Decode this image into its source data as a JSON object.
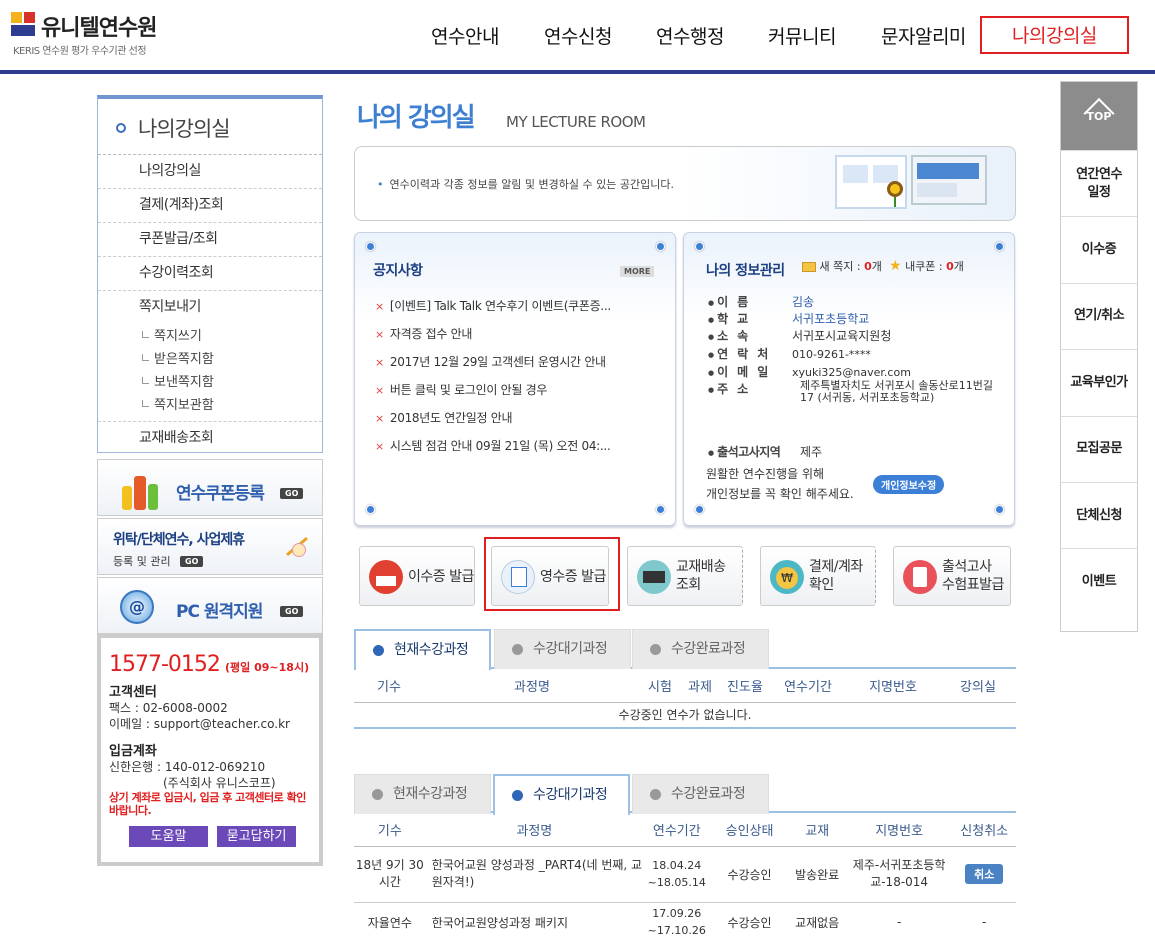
{
  "header": {
    "logo_title": "유니텔연수원",
    "logo_sub": "KERIS 연수원 평가 우수기관 선정",
    "nav": [
      "연수안내",
      "연수신청",
      "연수행정",
      "커뮤니티",
      "문자알리미",
      "나의강의실"
    ]
  },
  "lnb": {
    "title": "나의강의실",
    "items": [
      "나의강의실",
      "결제(계좌)조회",
      "쿠폰발급/조회",
      "수강이력조회",
      "쪽지보내기"
    ],
    "subitems": [
      "쪽지쓰기",
      "받은쪽지함",
      "보낸쪽지함",
      "쪽지보관함"
    ],
    "last_item": "교재배송조회"
  },
  "banners": {
    "coupon": "연수쿠폰등록",
    "group_title": "위탁/단체연수, 사업제휴",
    "group_sub": "등록 및 관리",
    "remote": "PC 원격지원",
    "go": "GO"
  },
  "cs": {
    "phone": "1577-0152",
    "hours": "(평일 09~18시)",
    "center_title": "고객센터",
    "fax": "팩스 : 02-6008-0002",
    "email": "이메일 : support@teacher.co.kr",
    "account_title": "입금계좌",
    "bank": "신한은행 : 140-012-069210",
    "holder": "(주식회사 유니스코프)",
    "warning": "상기 계좌로 입금시, 입금 후 고객센터로 확인 바랍니다.",
    "help_btn": "도움말",
    "qna_btn": "묻고답하기"
  },
  "main": {
    "title": "나의 강의실",
    "title_en": "MY LECTURE ROOM",
    "intro": "연수이력과 각종 정보를 알림 및 변경하실 수 있는 공간입니다."
  },
  "notice": {
    "title": "공지사항",
    "more": "MORE",
    "items": [
      "[이벤트] Talk Talk 연수후기 이벤트(쿠폰증...",
      "자격증 접수 안내",
      "2017년 12월 29일 고객센터 운영시간 안내",
      "버튼 클릭 및 로그인이 안될 경우",
      "2018년도 연간일정 안내",
      "시스템 점검 안내 09월 21일 (목) 오전 04:..."
    ]
  },
  "myinfo": {
    "title": "나의 정보관리",
    "msg_label": "새 쪽지 :",
    "msg_count": "0",
    "coupon_label": "내쿠폰 :",
    "coupon_count": "0",
    "unit": "개",
    "labels": [
      "이름",
      "학교",
      "소속",
      "연락처",
      "이메일",
      "주소"
    ],
    "name": "김송",
    "school": "서귀포초등학교",
    "org": "서귀포시교육지원청",
    "phone": "010-9261-****",
    "email": "xyuki325@naver.com",
    "address": "제주특별자치도 서귀포시 솔동산로11번길 17 (서귀동, 서귀포초등학교)",
    "exam_label": "출석고사지역",
    "exam_region": "제주",
    "notice1": "원활한 연수진행을 위해",
    "notice2": "개인정보를 꼭 확인 해주세요.",
    "edit_btn": "개인정보수정"
  },
  "quick": {
    "cert": "이수증 발급",
    "receipt": "영수증 발급",
    "delivery1": "교재배송",
    "delivery2": "조회",
    "pay1": "결제/계좌",
    "pay2": "확인",
    "exam1": "출석고사",
    "exam2": "수험표발급"
  },
  "tabs": [
    "현재수강과정",
    "수강대기과정",
    "수강완료과정"
  ],
  "table1": {
    "headers": [
      "기수",
      "과정명",
      "시험",
      "과제",
      "진도율",
      "연수기간",
      "지명번호",
      "강의실"
    ],
    "empty": "수강중인 연수가 없습니다."
  },
  "table2": {
    "headers": [
      "기수",
      "과정명",
      "연수기간",
      "승인상태",
      "교재",
      "지명번호",
      "신청취소"
    ],
    "rows": [
      {
        "term": "18년 9기 30시간",
        "course": "한국어교원 양성과정 _PART4(네 번째, 교원자격!)",
        "period": "18.04.24 ~18.05.14",
        "status": "수강승인",
        "book": "발송완료",
        "id": "제주-서귀포초등학교-18-014",
        "cancel": "취소"
      },
      {
        "term": "자율연수",
        "course": "한국어교원양성과정 패키지",
        "period": "17.09.26 ~17.10.26",
        "status": "수강승인",
        "book": "교재없음",
        "id": "-",
        "cancel": "-"
      }
    ]
  },
  "sidebar": {
    "top": "TOP",
    "items": [
      "연간연수 일정",
      "이수증",
      "연기/취소",
      "교육부인가",
      "모집공문",
      "단체신청",
      "이벤트"
    ]
  },
  "colors": {
    "accent": "#2e3c8f",
    "highlight": "#e02020",
    "title_blue": "#3d7fd1"
  }
}
